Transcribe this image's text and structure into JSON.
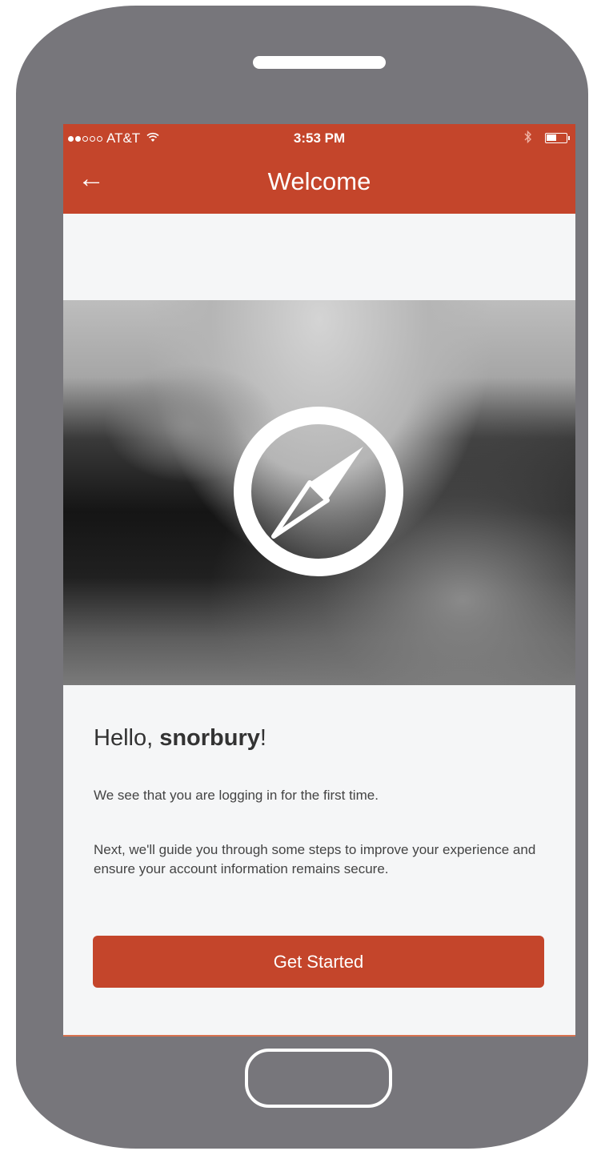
{
  "status_bar": {
    "carrier": "AT&T",
    "time": "3:53 PM"
  },
  "nav": {
    "back_glyph": "←",
    "title": "Welcome"
  },
  "welcome": {
    "greeting_prefix": "Hello, ",
    "username": "snorbury",
    "greeting_suffix": "!",
    "first_time_text": "We see that you are logging in for the first time.",
    "guide_text": "Next, we'll guide you through some steps to improve your experience and ensure your account information remains secure.",
    "cta_label": "Get Started"
  },
  "colors": {
    "brand": "#c4452b",
    "device_frame": "#77767b",
    "screen_bg": "#f5f6f7"
  },
  "icons": {
    "hero": "compass-icon",
    "back": "arrow-left-icon",
    "wifi": "wifi-icon",
    "bluetooth": "bluetooth-icon",
    "battery": "battery-icon"
  }
}
